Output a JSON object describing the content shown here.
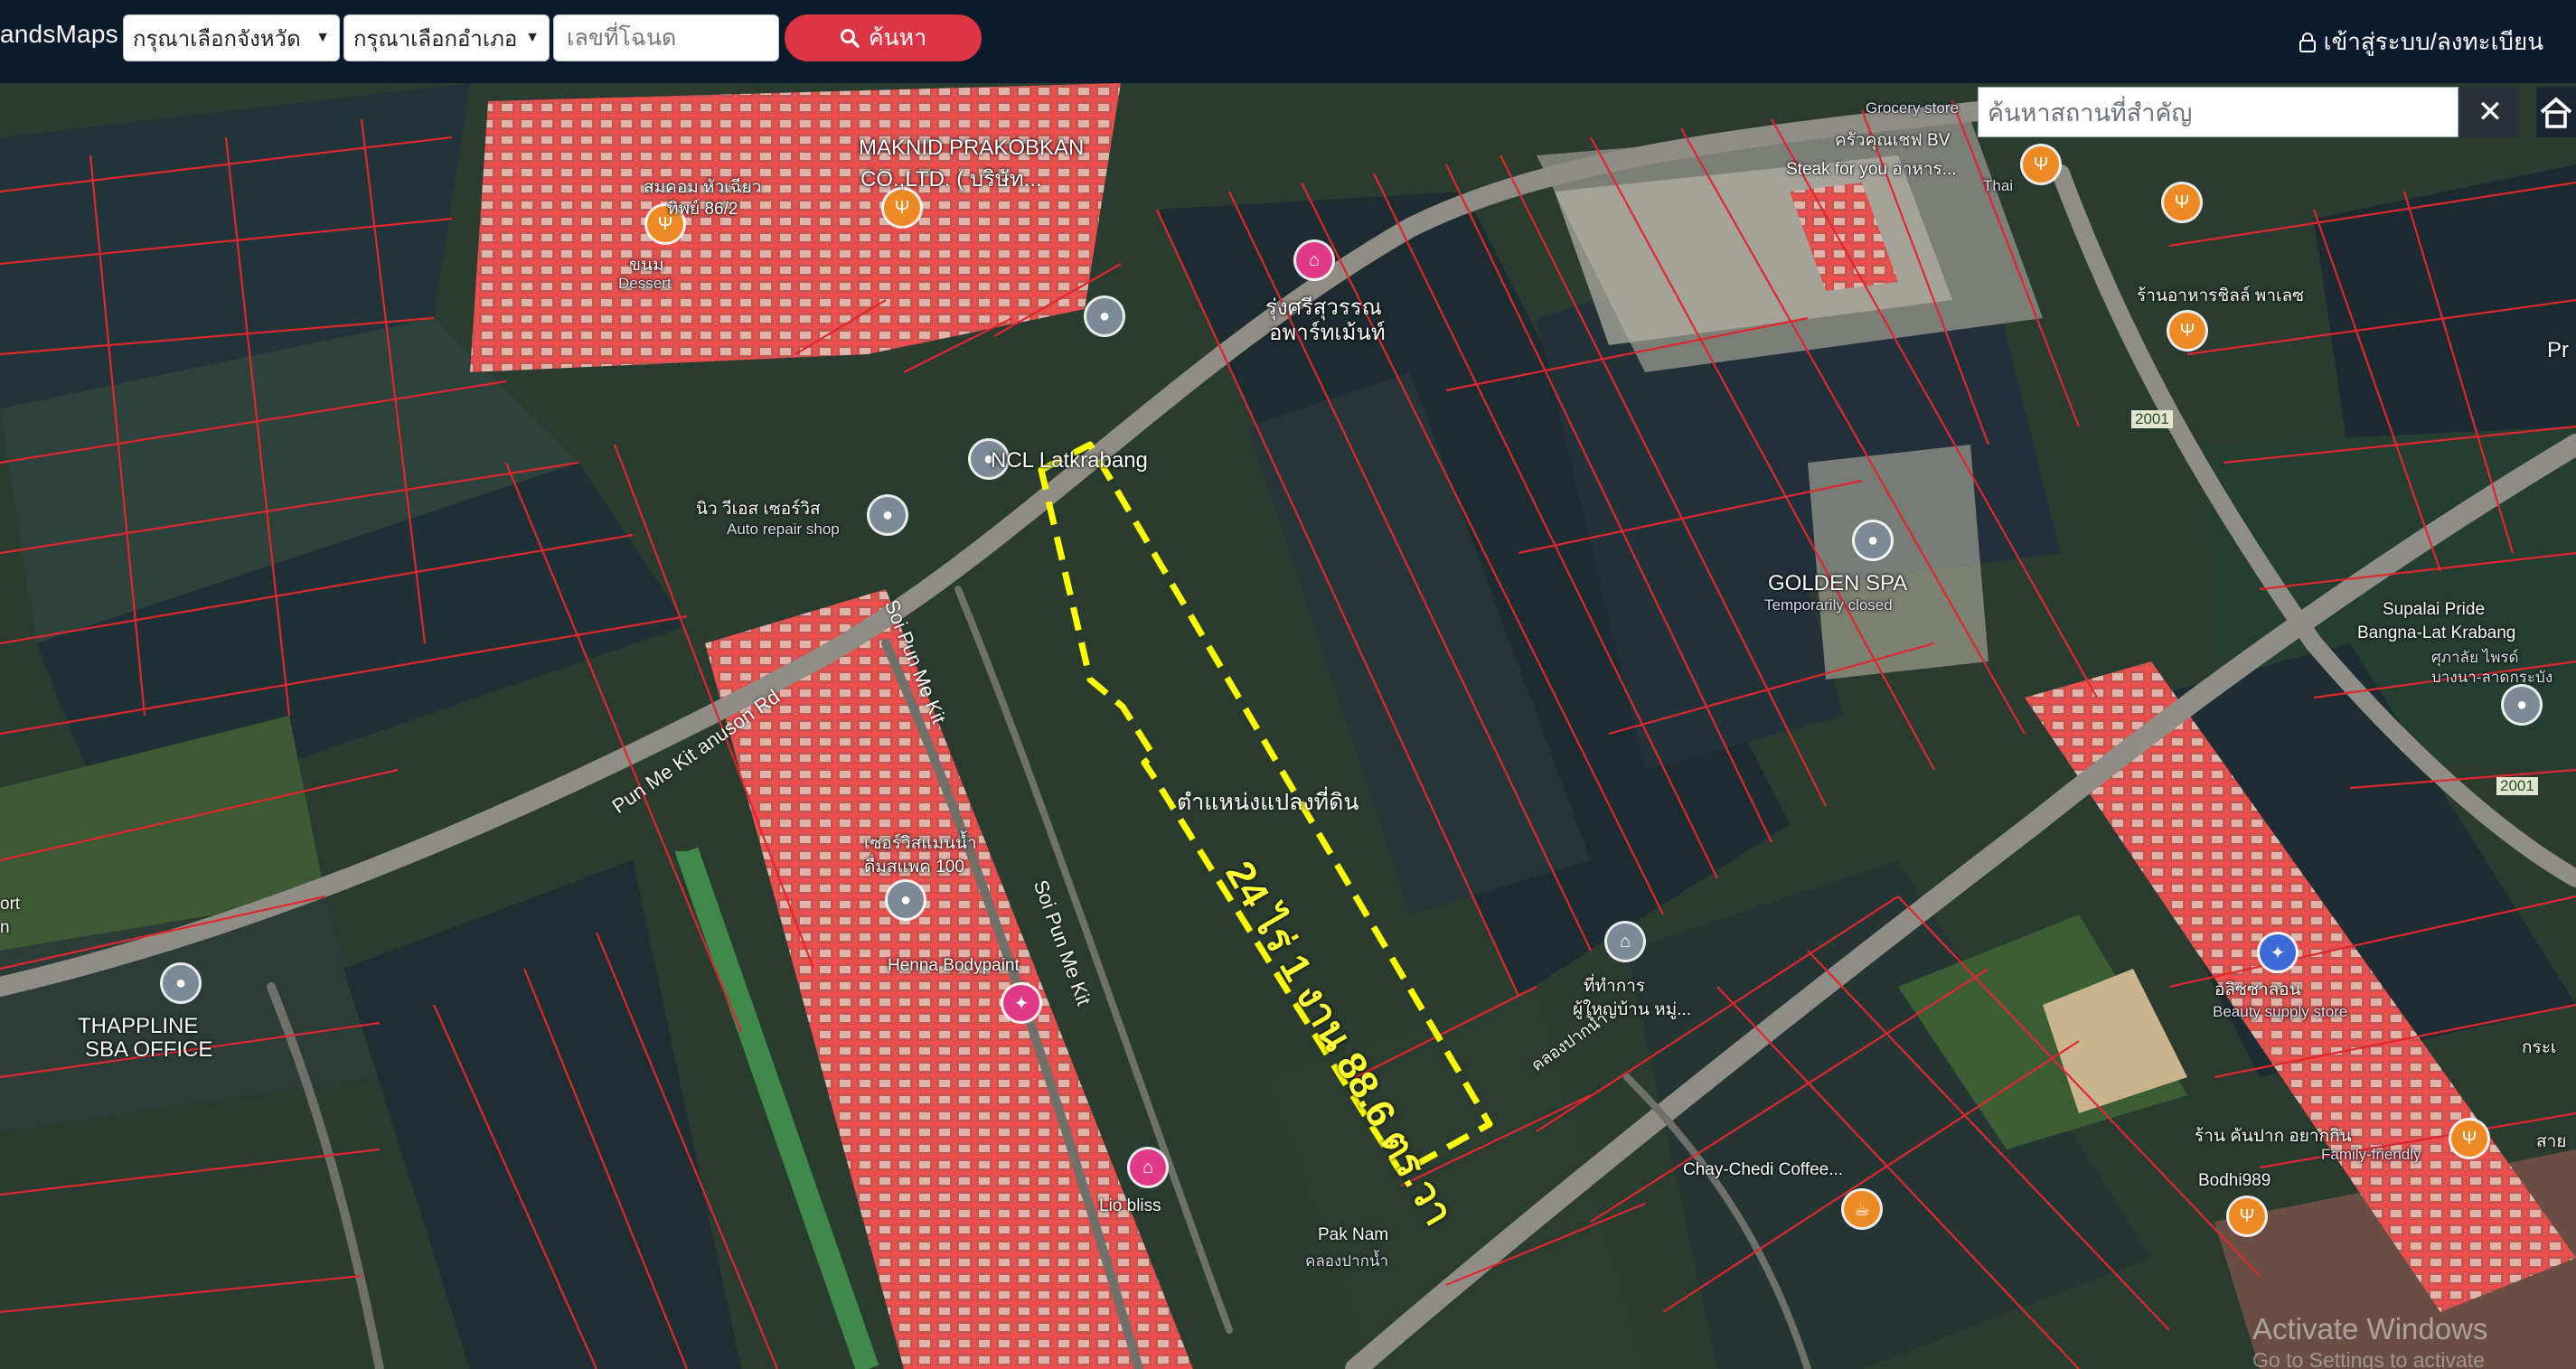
{
  "navbar": {
    "brand": "andsMaps",
    "province_select": "กรุณาเลือกจังหวัด",
    "district_select": "กรุณาเลือกอำเภอ",
    "deed_placeholder": "เลขที่โฉนด",
    "search_label": "ค้นหา",
    "login_label": "เข้าสู่ระบบ/ลงทะเบียน"
  },
  "landmark_search": {
    "placeholder": "ค้นหาสถานที่สำคัญ",
    "close_label": "✕"
  },
  "plot": {
    "area_label": "24 ไร่ 1 งาน 88.6 ตร.วา",
    "caption": "ตำแหน่งแปลงที่ดิน"
  },
  "places": {
    "ncl": "NCL Latkrabang",
    "repair": "นิว วีเอส เซอร์วิส",
    "repair_sub": "Auto repair shop",
    "maknid": "MAKNID PRAKOBKAN",
    "maknid_sub": "CO.,LTD. ( บริษัท...",
    "somkom": "สมคอม หัวเฉียว",
    "somkom_sub": "ทิพย์ 86/2",
    "dessert": "ขนม",
    "dessert_sub": "Dessert",
    "rungsri": "รุ่งศรีสุวรรณ",
    "rungsri_sub": "อพาร์ทเม้นท์",
    "steak": "Steak for you อาหาร...",
    "thai": "Thai",
    "grocery": "Grocery store",
    "kitchen": "ครัวคุณเชฟ BV",
    "restaurant": "ร้านอาหารชิลล์ พาเลซ",
    "golden": "GOLDEN SPA",
    "golden_sub": "Temporarily closed",
    "supalai": "Supalai Pride",
    "supalai2": "Bangna-Lat Krabang",
    "supalai_sub": "ศุภาลัย ไพรด์",
    "supalai_sub2": "บางนา-ลาดกระบัง",
    "pr": "Pr",
    "serve": "เซอร์วิสแมนน้ำ",
    "serve2": "ดื่มสแพค 100",
    "henna": "Henna Bodypaint",
    "thappline": "THAPPLINE",
    "thappline2": "SBA OFFICE",
    "ort": "ort",
    "n": "n",
    "office": "ที่ทำการ",
    "office2": "ผู้ใหญ่บ้าน หมู่...",
    "beauty": "อลิซซาลอน",
    "beauty_sub": "Beauty supply store",
    "chay": "Chay-Chedi Coffee...",
    "lio": "Lio bliss",
    "paknam": "Pak Nam",
    "paknam_sub": "คลองปากน้ำ",
    "kanpak": "ร้าน คันปาก อยากกิน",
    "family": "Family-friendly",
    "bodhi": "Bodhi989",
    "kra": "กระเ",
    "sao": "สาย"
  },
  "roads": {
    "punme_kit_anusorn": "Pun Me Kit anuson Rd",
    "soi_punmekit1": "Soi Pun Me Kit",
    "soi_punmekit2": "Soi Pun Me Kit",
    "klong": "คลองปากน้ำ",
    "route_2001a": "2001",
    "route_2001b": "2001"
  },
  "watermark": {
    "title": "Activate Windows",
    "sub": "Go to Settings to activate Windows."
  },
  "colors": {
    "navbar": "#0b1a2c",
    "search_button": "#dc3545",
    "parcel_lines": "#e0272e",
    "plot_outline": "#ffff00"
  }
}
